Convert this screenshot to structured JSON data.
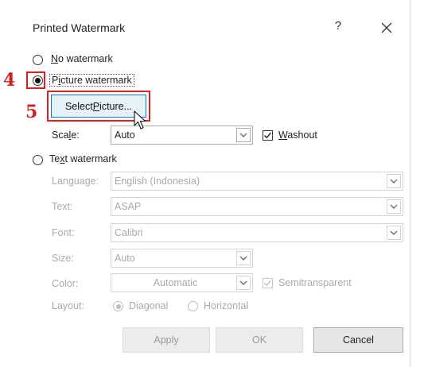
{
  "dialog": {
    "title": "Printed Watermark",
    "help": "?",
    "close": "✕"
  },
  "annotations": {
    "step4": "4",
    "step5": "5"
  },
  "no_watermark": {
    "pre": "",
    "u": "N",
    "post": "o watermark",
    "selected": false
  },
  "picture_watermark": {
    "pre": "P",
    "u": "i",
    "post": "cture watermark",
    "selected": true,
    "select_button": {
      "pre": "Select ",
      "u": "P",
      "post": "icture..."
    },
    "scale_label": {
      "pre": "Sca",
      "u": "l",
      "post": "e:"
    },
    "scale_value": "Auto",
    "washout": {
      "pre": "",
      "u": "W",
      "post": "ashout",
      "checked": true
    }
  },
  "text_watermark": {
    "pre": "Te",
    "u": "x",
    "post": "t watermark",
    "selected": false,
    "language_label": "Language:",
    "language_value": "English (Indonesia)",
    "text_label": "Text:",
    "text_value": "ASAP",
    "font_label": "Font:",
    "font_value": "Calibri",
    "size_label": "Size:",
    "size_value": "Auto",
    "color_label": "Color:",
    "color_value": "Automatic",
    "semitransparent_label": "Semitransparent",
    "semitransparent_checked": true,
    "layout_label": "Layout:",
    "diagonal_label": "Diagonal",
    "diagonal_selected": true,
    "horizontal_label": "Horizontal",
    "horizontal_selected": false
  },
  "buttons": {
    "apply": "Apply",
    "ok": "OK",
    "cancel": "Cancel"
  },
  "icons": {
    "close": "close-icon",
    "help": "help-icon",
    "chevron": "chevron-down-icon",
    "check": "checkmark-icon",
    "cursor": "mouse-pointer-icon"
  }
}
